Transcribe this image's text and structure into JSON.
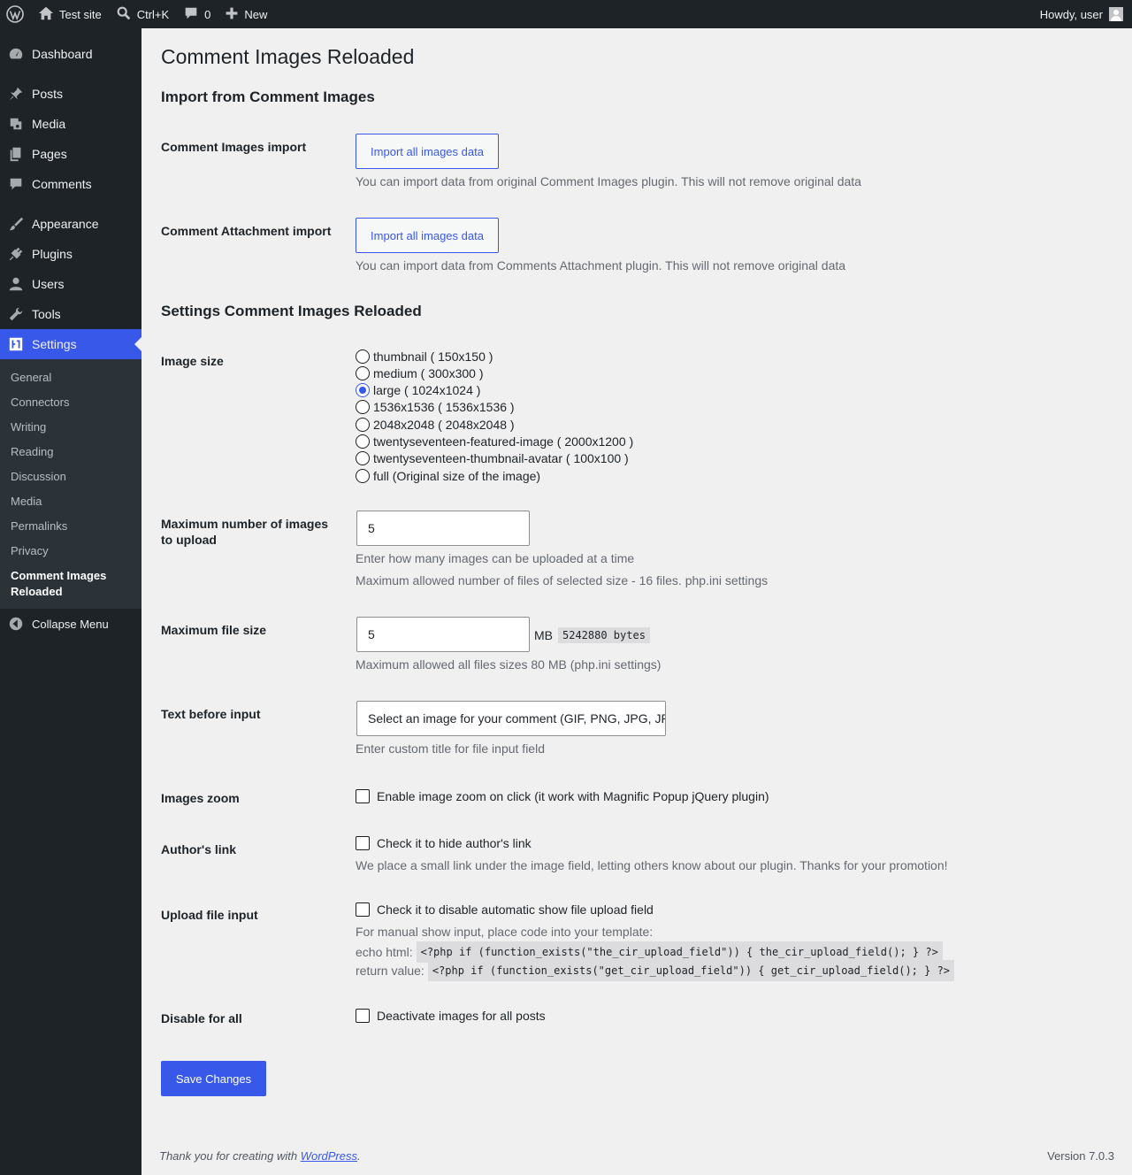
{
  "adminbar": {
    "site_name": "Test site",
    "search_shortcut": "Ctrl+K",
    "comments_count": "0",
    "new_label": "New",
    "howdy": "Howdy, user"
  },
  "sidebar": {
    "items": [
      {
        "label": "Dashboard",
        "icon": "dashboard-icon"
      },
      {
        "label": "Posts",
        "icon": "pin-icon"
      },
      {
        "label": "Media",
        "icon": "media-icon"
      },
      {
        "label": "Pages",
        "icon": "pages-icon"
      },
      {
        "label": "Comments",
        "icon": "comment-icon"
      },
      {
        "label": "Appearance",
        "icon": "brush-icon"
      },
      {
        "label": "Plugins",
        "icon": "plug-icon"
      },
      {
        "label": "Users",
        "icon": "user-icon"
      },
      {
        "label": "Tools",
        "icon": "wrench-icon"
      },
      {
        "label": "Settings",
        "icon": "settings-icon"
      }
    ],
    "submenu": [
      "General",
      "Connectors",
      "Writing",
      "Reading",
      "Discussion",
      "Media",
      "Permalinks",
      "Privacy",
      "Comment Images Reloaded"
    ],
    "collapse_label": "Collapse Menu"
  },
  "page": {
    "title": "Comment Images Reloaded",
    "import_heading": "Import from Comment Images",
    "ci_import_label": "Comment Images import",
    "ci_import_button": "Import all images data",
    "ci_import_desc": "You can import data from original Comment Images plugin. This will not remove original data",
    "ca_import_label": "Comment Attachment import",
    "ca_import_button": "Import all images data",
    "ca_import_desc": "You can import data from Comments Attachment plugin. This will not remove original data",
    "settings_heading": "Settings Comment Images Reloaded",
    "image_size_label": "Image size",
    "image_sizes": [
      {
        "label": "thumbnail ( 150x150 )",
        "checked": false
      },
      {
        "label": "medium ( 300x300 )",
        "checked": false
      },
      {
        "label": "large ( 1024x1024 )",
        "checked": true
      },
      {
        "label": "1536x1536 ( 1536x1536 )",
        "checked": false
      },
      {
        "label": "2048x2048 ( 2048x2048 )",
        "checked": false
      },
      {
        "label": "twentyseventeen-featured-image ( 2000x1200 )",
        "checked": false
      },
      {
        "label": "twentyseventeen-thumbnail-avatar ( 100x100 )",
        "checked": false
      },
      {
        "label": "full (Original size of the image)",
        "checked": false
      }
    ],
    "max_images_label": "Maximum number of images to upload",
    "max_images_value": "5",
    "max_images_desc1": "Enter how many images can be uploaded at a time",
    "max_images_desc2": "Maximum allowed number of files of selected size - 16 files. php.ini settings",
    "max_file_label": "Maximum file size",
    "max_file_value": "5",
    "max_file_unit": "MB",
    "max_file_bytes": "5242880 bytes",
    "max_file_desc": "Maximum allowed all files sizes 80 MB (php.ini settings)",
    "text_before_label": "Text before input",
    "text_before_value": "Select an image for your comment (GIF, PNG, JPG, JPEG):",
    "text_before_desc": "Enter custom title for file input field",
    "zoom_label": "Images zoom",
    "zoom_check": "Enable image zoom on click (it work with Magnific Popup jQuery plugin)",
    "author_label": "Author's link",
    "author_check": "Check it to hide author's link",
    "author_desc": "We place a small link under the image field, letting others know about our plugin. Thanks for your promotion!",
    "upload_label": "Upload file input",
    "upload_check": "Check it to disable automatic show file upload field",
    "upload_desc": "For manual show input, place code into your template:",
    "echo_label": "echo html:",
    "echo_code": "<?php if (function_exists(\"the_cir_upload_field\")) { the_cir_upload_field(); } ?>",
    "return_label": "return value:",
    "return_code": "<?php if (function_exists(\"get_cir_upload_field\")) { get_cir_upload_field(); } ?>",
    "disable_label": "Disable for all",
    "disable_check": "Deactivate images for all posts",
    "save_button": "Save Changes"
  },
  "footer": {
    "thanks_prefix": "Thank you for creating with ",
    "thanks_link": "WordPress",
    "thanks_suffix": ".",
    "version": "Version 7.0.3"
  }
}
